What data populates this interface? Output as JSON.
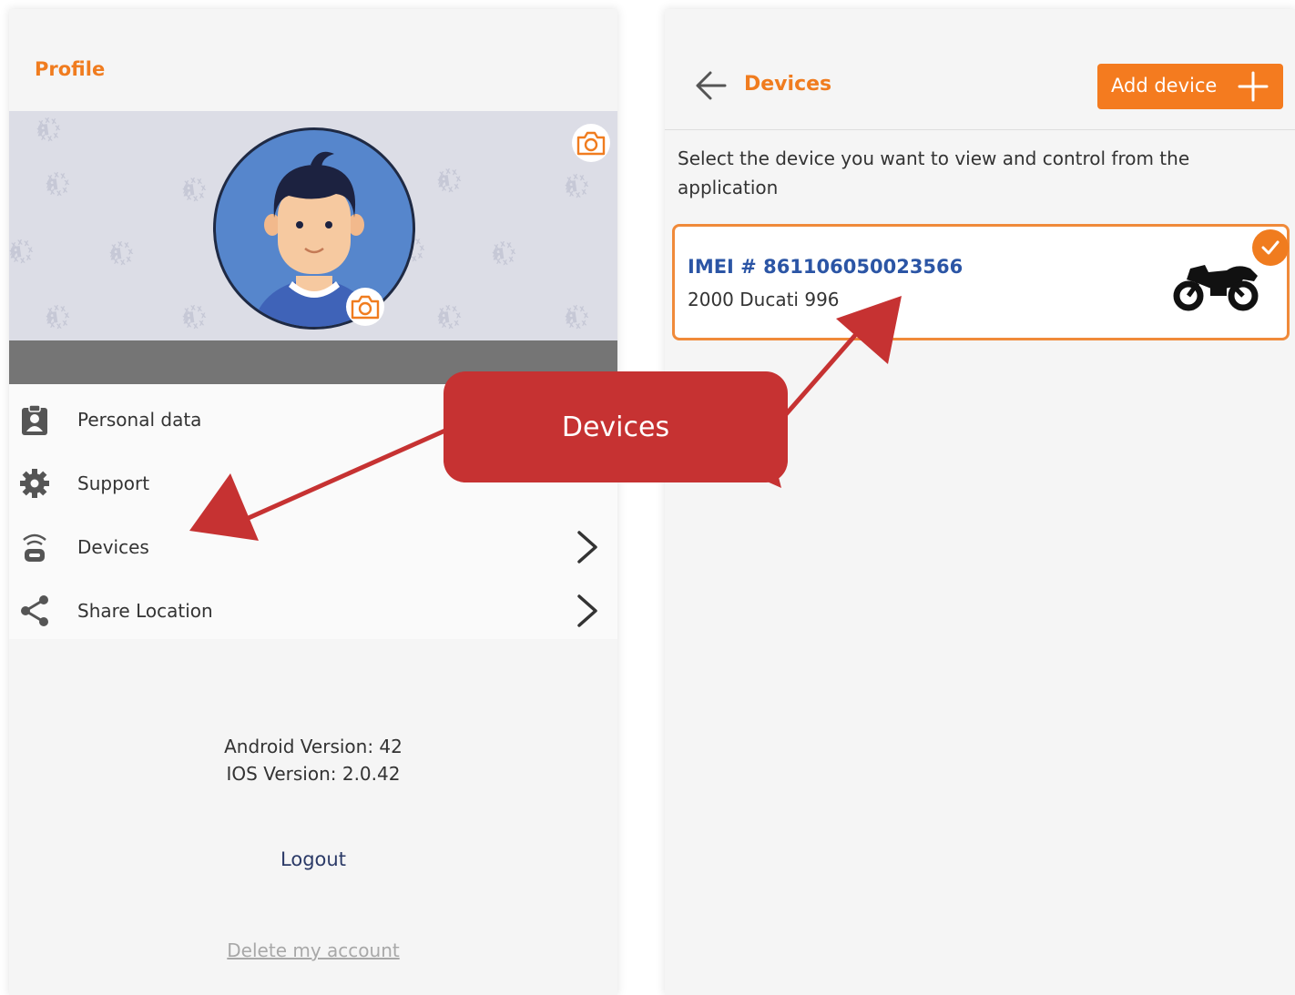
{
  "profile": {
    "title": "Profile",
    "menu": [
      {
        "label": "Personal data",
        "icon": "clipboard-person-icon"
      },
      {
        "label": "Support",
        "icon": "gear-icon"
      },
      {
        "label": "Devices",
        "icon": "wifi-device-icon"
      },
      {
        "label": "Share Location",
        "icon": "share-icon"
      }
    ],
    "android_version": "Android Version: 42",
    "ios_version": "IOS Version: 2.0.42",
    "logout": "Logout",
    "delete_account": "Delete my account"
  },
  "devices": {
    "title": "Devices",
    "add_button": "Add device",
    "description": "Select the device you want to view and control from the application",
    "items": [
      {
        "imei": "IMEI # 861106050023566",
        "name": "2000 Ducati 996",
        "selected": true,
        "icon": "motorcycle-icon"
      }
    ]
  },
  "callout": {
    "label": "Devices"
  },
  "colors": {
    "accent": "#f07c1f",
    "callout": "#c63232",
    "imei": "#2b55a5"
  }
}
